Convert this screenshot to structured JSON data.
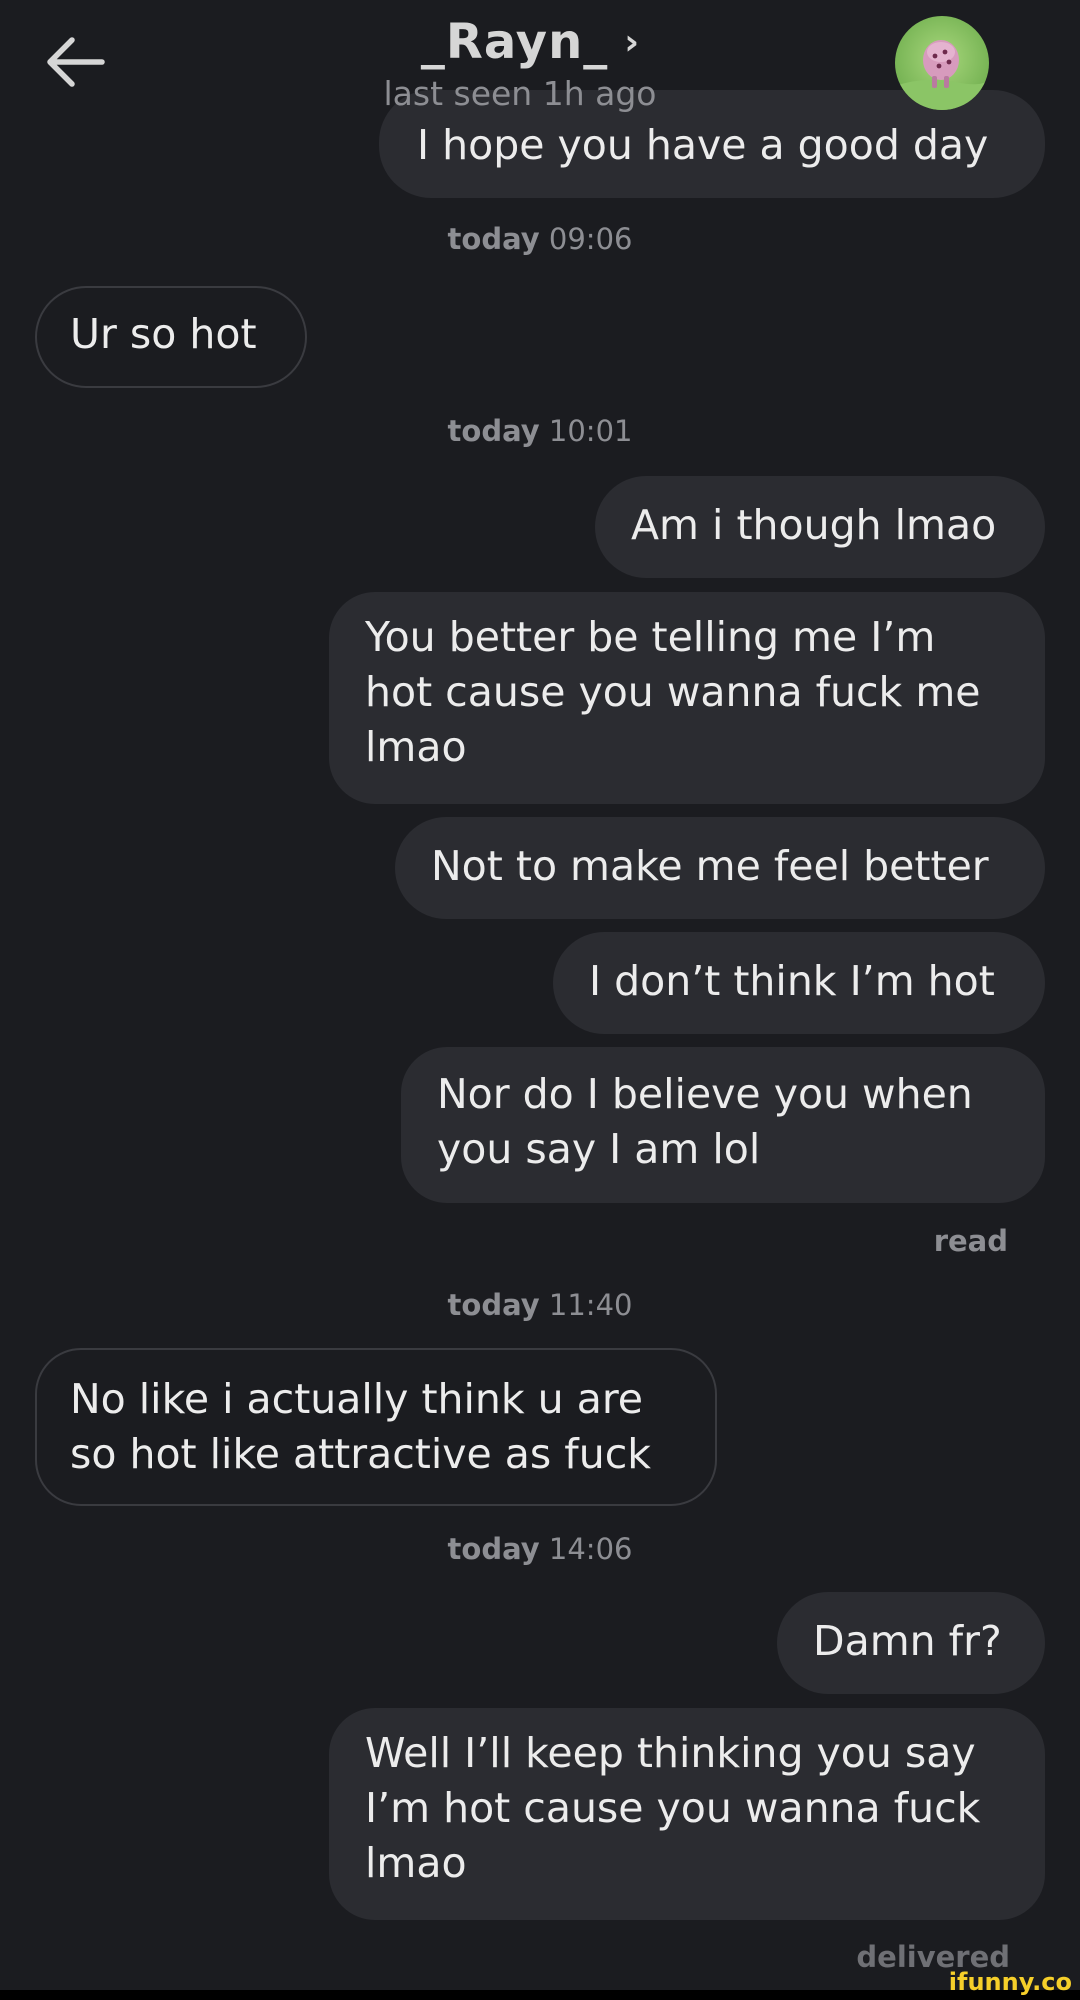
{
  "header": {
    "back_icon": "arrow-left-icon",
    "contact_name": "_Rayn_",
    "chevron": "›",
    "last_seen": "last seen 1h ago",
    "avatar_icon": "profile-avatar"
  },
  "messages": {
    "m1": "I hope you have a good day",
    "t1": {
      "label": "today",
      "time": "09:06"
    },
    "m2": "Ur so hot",
    "t2": {
      "label": "today",
      "time": "10:01"
    },
    "m3": "Am i though lmao",
    "m4": "You better be telling me I’m\nhot cause you wanna fuck me\nlmao",
    "m5": "Not to make me feel better",
    "m6": "I don’t think I’m hot",
    "m7": "Nor do I believe you when\nyou say I am lol",
    "read": "read",
    "t3": {
      "label": "today",
      "time": "11:40"
    },
    "m8": "No like i actually think u are\nso hot like attractive as fuck",
    "t4": {
      "label": "today",
      "time": "14:06"
    },
    "m9": "Damn fr?",
    "m10": "Well I’ll keep thinking you say\nI’m hot cause you wanna fuck\nlmao",
    "delivered": "delivered"
  },
  "watermark": "ifunny.co",
  "colors": {
    "background": "#1b1c20",
    "outgoing_bubble": "#2b2c31",
    "incoming_border": "#3a3b40",
    "muted_text": "#8d8e93",
    "text": "#ececec"
  }
}
